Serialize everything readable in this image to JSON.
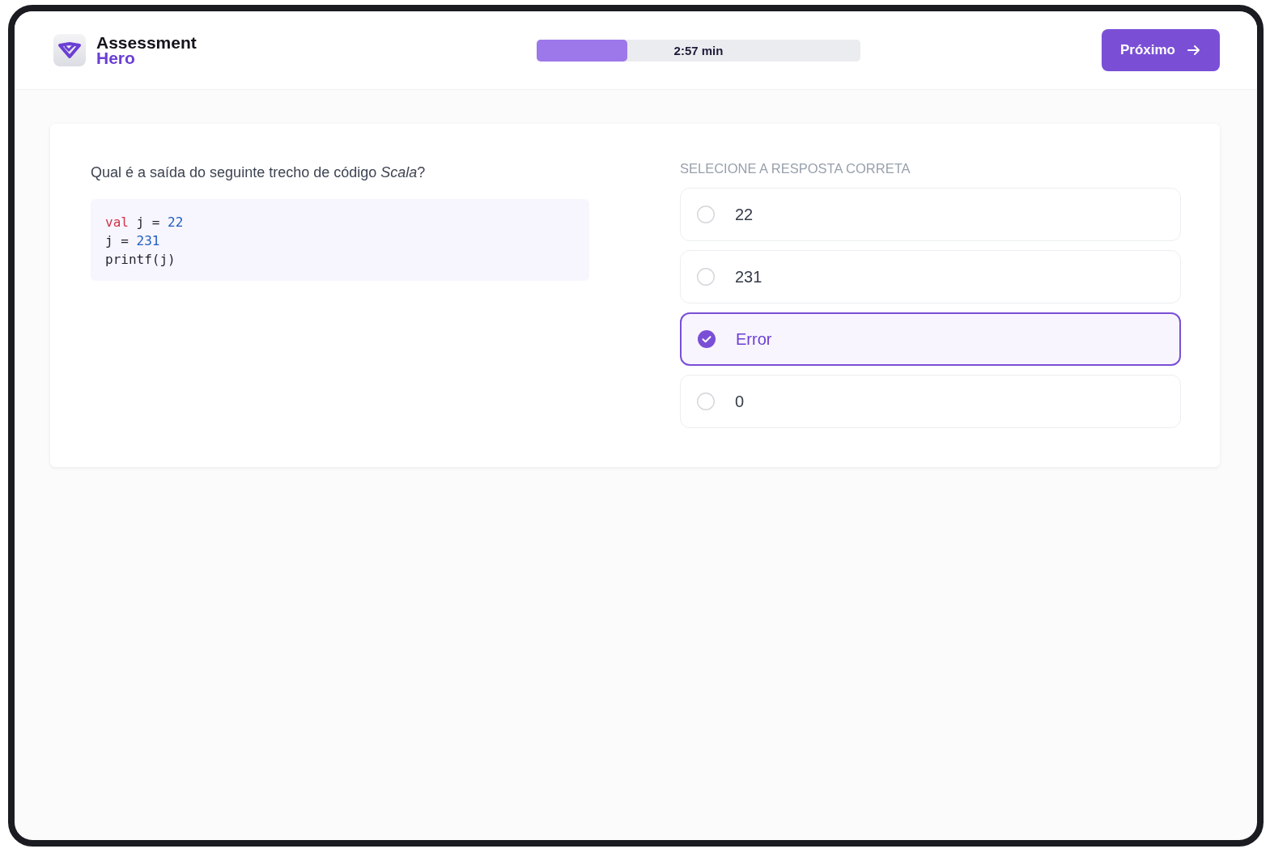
{
  "header": {
    "logo": {
      "line_1": "Assessment",
      "line_2": "Hero"
    },
    "timer": {
      "level": 0.28,
      "reading": "2:57 min"
    },
    "next_button": "Próximo"
  },
  "question": {
    "text": "Qual é a saída do seguinte trecho de código *Scala*?",
    "code": [
      [
        {
          "kind": "keyword",
          "text": "val"
        },
        {
          "kind": "plain",
          "text": " j = "
        },
        {
          "kind": "number",
          "text": "22"
        }
      ],
      [
        {
          "kind": "plain",
          "text": "j = "
        },
        {
          "kind": "number",
          "text": "231"
        }
      ],
      [
        {
          "kind": "plain",
          "text": "printf(j)"
        }
      ]
    ]
  },
  "answers": {
    "heading": "SELECIONE A RESPOSTA CORRETA",
    "options": [
      {
        "label": "22",
        "selected": false
      },
      {
        "label": "231",
        "selected": false
      },
      {
        "label": "Error",
        "selected": true
      },
      {
        "label": "0",
        "selected": false
      }
    ]
  }
}
